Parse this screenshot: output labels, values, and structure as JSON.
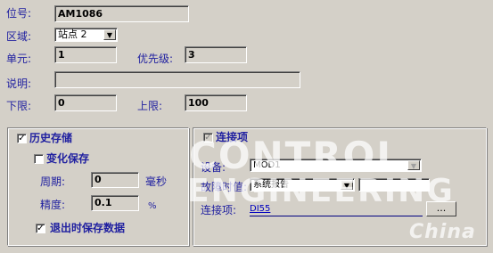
{
  "form": {
    "tag": {
      "label": "位号:",
      "value": "AM1086"
    },
    "area": {
      "label": "区域:",
      "value": "站点 2"
    },
    "unit": {
      "label": "单元:",
      "value": "1"
    },
    "priority": {
      "label": "优先级:",
      "value": "3"
    },
    "description": {
      "label": "说明:",
      "value": ""
    },
    "low_limit": {
      "label": "下限:",
      "value": "0"
    },
    "high_limit": {
      "label": "上限:",
      "value": "100"
    }
  },
  "history": {
    "title": "历史存储",
    "checked": true,
    "change_save": {
      "label": "变化保存",
      "checked": false
    },
    "period": {
      "label": "周期:",
      "value": "0",
      "unit": "毫秒"
    },
    "precision": {
      "label": "精度:",
      "value": "0.1",
      "unit": "%"
    },
    "save_on_exit": {
      "label": "退出时保存数据",
      "checked": true
    }
  },
  "connection": {
    "title": "连接项",
    "checked": true,
    "device": {
      "label": "设备:",
      "value": "MOD1"
    },
    "fault_value": {
      "label": "故障时值:",
      "value": "系统报告"
    },
    "connection_item": {
      "label": "连接项:",
      "value": "DI55",
      "button": "..."
    }
  },
  "watermark": {
    "line1": "CONTROL",
    "line2": "ENGINEERING",
    "line3": "China"
  }
}
